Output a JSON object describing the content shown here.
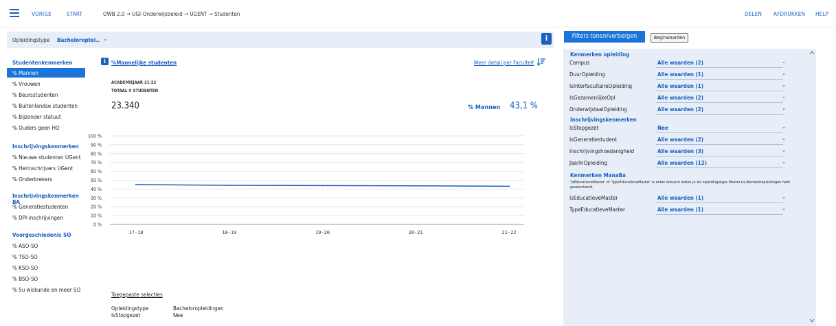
{
  "topbar": {
    "back_label": "VORIGE",
    "start_label": "START",
    "breadcrumb": "OWB 2.0 → UGI-Onderwijsbeleid → UGENT → Studenten",
    "share_label": "DELEN",
    "print_label": "AFDRUKKEN",
    "help_label": "HELP"
  },
  "filter": {
    "label": "Opleidingstype",
    "value": "Bacheloroptei..",
    "info": "i"
  },
  "sidebar": {
    "sections": [
      {
        "title": "Studentenkenmerken",
        "items": [
          "% Mannen",
          "% Vrouwen",
          "% Beursstudenten",
          "% Buitenlandse studenten",
          "% Bijzonder statuut",
          "% Ouders geen HO"
        ]
      },
      {
        "title": "Inschrijvingskenmerken",
        "items": [
          "% Nieuwe studenten UGent",
          "% Herinschrijvers UGent",
          "% Onderbrekers"
        ]
      },
      {
        "title": "Inschrijvingskenmerken BA",
        "items": [
          "% Generatiestudenten",
          "% DPI-inschrijvingen"
        ]
      },
      {
        "title": "Voorgeschiedenis SO",
        "items": [
          "% ASO-SO",
          "% TSO-SO",
          "% KSO-SO",
          "% BSO-SO",
          "% 5u wiskunde en meer SO"
        ]
      }
    ],
    "active_item": "% Mannen"
  },
  "main": {
    "title": "%Mannelijke studenten",
    "detail_link": "Meer detail per Faculteit",
    "academic_year": "ACADEMIEJAAR 21-22",
    "total_label": "TOTAAL # STUDENTEN",
    "total_value": "23.340",
    "pct_label": "% Mannen",
    "pct_value": "43,1 %",
    "info": "i"
  },
  "chart_data": {
    "type": "line",
    "categories": [
      "17-18",
      "18-19",
      "19-20",
      "20-21",
      "21-22"
    ],
    "series": [
      {
        "values": [
          45.0,
          44.2,
          43.9,
          43.6,
          43.1
        ]
      }
    ],
    "yticks": [
      "0 %",
      "10 %",
      "20 %",
      "30 %",
      "40 %",
      "50 %",
      "60 %",
      "70 %",
      "80 %",
      "90 %",
      "100 %"
    ],
    "ylim": [
      0,
      100
    ],
    "grid": true,
    "line_color": "#1b5fbf"
  },
  "applied": {
    "title": "Toegepaste selecties",
    "rows": [
      {
        "key": "Opleidingstype",
        "value": "Bacheloropleidingen"
      },
      {
        "key": "IsStopgezet",
        "value": "Nee"
      }
    ]
  },
  "right": {
    "toggle_label": "Filters tonen/verbergen",
    "reset_label": "Beginwaarden",
    "groups": [
      {
        "title": "Kenmerken opleiding",
        "rows": [
          {
            "label": "Campus",
            "value": "Alle waarden (2)"
          },
          {
            "label": "DuurOpleiding",
            "value": "Alle waarden (1)"
          },
          {
            "label": "IsInterfacultaireOpleiding",
            "value": "Alle waarden (1)"
          },
          {
            "label": "IsGezamenlijkeOpl",
            "value": "Alle waarden (2)"
          },
          {
            "label": "OnderwijstaalOpleiding",
            "value": "Alle waarden (2)"
          }
        ]
      },
      {
        "title": "Inschrijvingskenmerken",
        "rows": [
          {
            "label": "IsStopgezet",
            "value": "Nee"
          },
          {
            "label": "IsGeneratiestudent",
            "value": "Alle waarden (2)"
          },
          {
            "label": "Inschrijvingshoedanigheid",
            "value": "Alle waarden (3)"
          },
          {
            "label": "JaarInOpleiding",
            "value": "Alle waarden (12)"
          }
        ]
      },
      {
        "title": "Kenmerken ManaBa",
        "note": "'IsEducatieveMaster' of 'TypeEducatieveMaster' is enkel relevant indien je als opleidingstype Master-na-Bacheloropleidingen hebt geselecteerd.",
        "rows": [
          {
            "label": "IsEducatieveMaster",
            "value": "Alle waarden (1)"
          },
          {
            "label": "TypeEducatieveMaster",
            "value": "Alle waarden (1)"
          }
        ]
      }
    ]
  }
}
